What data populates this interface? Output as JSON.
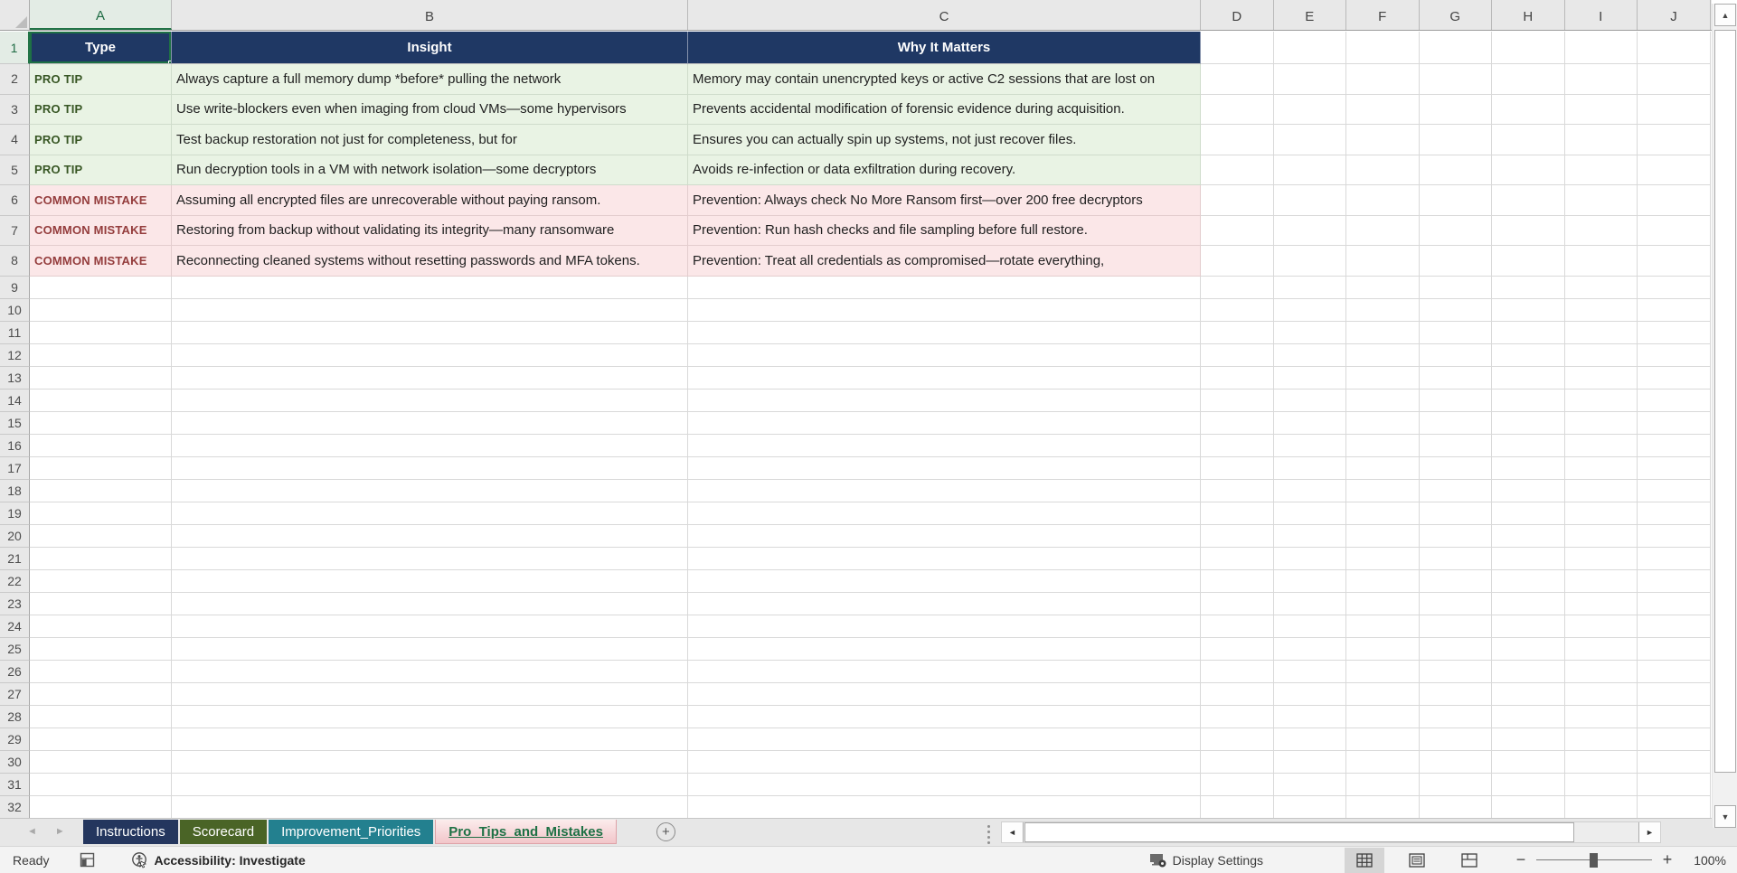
{
  "sheet": {
    "columns": [
      "A",
      "B",
      "C",
      "D",
      "E",
      "F",
      "G",
      "H",
      "I",
      "J"
    ],
    "row_numbers": [
      1,
      2,
      3,
      4,
      5,
      6,
      7,
      8,
      9,
      10,
      11,
      12,
      13,
      14,
      15,
      16,
      17,
      18,
      19,
      20,
      21,
      22,
      23,
      24,
      25,
      26,
      27,
      28,
      29,
      30,
      31,
      32
    ],
    "selected_cell": "A1"
  },
  "table": {
    "headers": [
      "Type",
      "Insight",
      "Why It Matters"
    ],
    "rows": [
      {
        "type": "PRO TIP",
        "category": "tip",
        "insight": "Always capture a full memory dump *before* pulling the network",
        "why": "Memory may contain unencrypted keys or active C2 sessions that are lost on"
      },
      {
        "type": "PRO TIP",
        "category": "tip",
        "insight": "Use write-blockers even when imaging from cloud VMs—some hypervisors",
        "why": "Prevents accidental modification of forensic evidence during acquisition."
      },
      {
        "type": "PRO TIP",
        "category": "tip",
        "insight": "Test backup restoration not just for completeness, but for",
        "why": "Ensures you can actually spin up systems, not just recover files."
      },
      {
        "type": "PRO TIP",
        "category": "tip",
        "insight": "Run decryption tools in a VM with network isolation—some decryptors",
        "why": "Avoids re-infection or data exfiltration during recovery."
      },
      {
        "type": "COMMON MISTAKE",
        "category": "mistake",
        "insight": "Assuming all encrypted files are unrecoverable without paying ransom.",
        "why": "Prevention: Always check No More Ransom first—over 200 free decryptors"
      },
      {
        "type": "COMMON MISTAKE",
        "category": "mistake",
        "insight": "Restoring from backup without validating its integrity—many ransomware",
        "why": "Prevention: Run hash checks and file sampling before full restore."
      },
      {
        "type": "COMMON MISTAKE",
        "category": "mistake",
        "insight": "Reconnecting cleaned systems without resetting passwords and MFA tokens.",
        "why": "Prevention: Treat all credentials as compromised—rotate everything,"
      }
    ]
  },
  "tabs": [
    {
      "label": "Instructions",
      "color": "#24365E",
      "active": false
    },
    {
      "label": "Scorecard",
      "color": "#4A6426",
      "active": false
    },
    {
      "label": "Improvement_Priorities",
      "color": "#23808F",
      "active": false
    },
    {
      "label": "Pro_Tips_and_Mistakes",
      "color": "#F2C6CA",
      "active": true
    }
  ],
  "status_bar": {
    "mode": "Ready",
    "accessibility": "Accessibility: Investigate",
    "display_settings": "Display Settings",
    "zoom_level": "100%"
  },
  "colors": {
    "header_fill": "#1F3864",
    "tip_bg": "#E9F3E4",
    "tip_text": "#375623",
    "mistake_bg": "#FBE7E8",
    "mistake_text": "#943C3C",
    "accent_green": "#217346"
  }
}
